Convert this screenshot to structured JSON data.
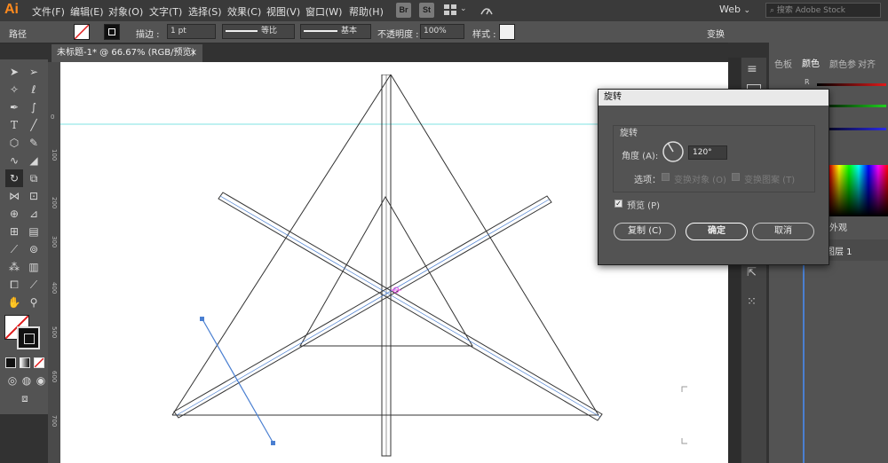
{
  "menubar": {
    "logo": "Ai",
    "items": [
      "文件(F)",
      "编辑(E)",
      "对象(O)",
      "文字(T)",
      "选择(S)",
      "效果(C)",
      "视图(V)",
      "窗口(W)",
      "帮助(H)"
    ],
    "bridge": "Br",
    "stock": "St",
    "workspace": "Web",
    "search_placeholder": "搜索 Adobe Stock"
  },
  "control_bar": {
    "selection_label": "路径",
    "stroke_label": "描边 :",
    "stroke_weight": "1 pt",
    "profile_label": "等比",
    "brush_label": "基本",
    "opacity_label": "不透明度 :",
    "opacity_value": "100%",
    "style_label": "样式 :",
    "transform_label": "变换"
  },
  "document": {
    "tab_title": "未标题-1* @ 66.67% (RGB/预览)",
    "close_glyph": "×"
  },
  "rulers": {
    "top": [
      "100",
      "200",
      "300",
      "400",
      "500",
      "600",
      "700",
      "800"
    ],
    "left": [
      "0",
      "100",
      "200",
      "300",
      "400",
      "500",
      "600",
      "700"
    ]
  },
  "panels": {
    "color_tabs": [
      "色板",
      "颜色",
      "颜色参",
      "对齐"
    ],
    "color_channels": [
      "R",
      "G",
      "B"
    ],
    "appearance_tab": "外观",
    "layer_name": "图层 1"
  },
  "dialog": {
    "title": "旋转",
    "group_label": "旋转",
    "angle_label": "角度 (A):",
    "angle_value": "120°",
    "options_label": "选项：",
    "transform_objects": "变换对象 (O)",
    "transform_patterns": "变换图案 (T)",
    "preview_label": "预览 (P)",
    "copy_button": "复制 (C)",
    "ok_button": "确定",
    "cancel_button": "取消"
  },
  "colors": {
    "guide": "#7fe3e3",
    "selection": "#4a7fd1",
    "accent": "#ff8a1e"
  }
}
